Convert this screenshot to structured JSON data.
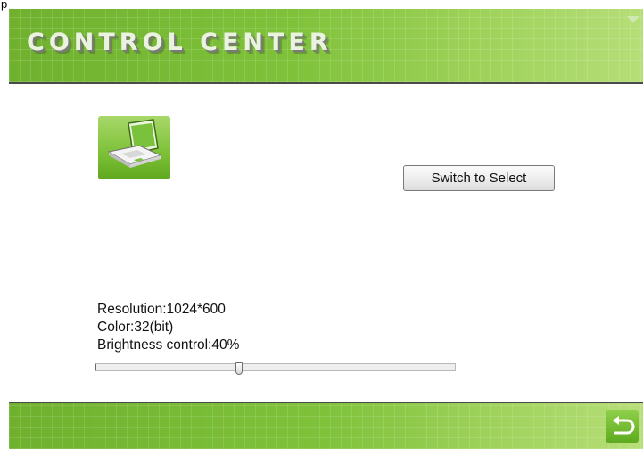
{
  "window": {
    "title": "p"
  },
  "header": {
    "title": "CONTROL CENTER"
  },
  "buttons": {
    "switch_label": "Switch to Select"
  },
  "display": {
    "resolution": "Resolution:1024*600",
    "color": "Color:32(bit)",
    "brightness": "Brightness control:40%"
  },
  "brightness_slider": {
    "value_percent": 40
  },
  "icons": {
    "device": "laptop-icon",
    "back": "return-arrow-icon",
    "collapse": "triangle-down-icon"
  },
  "colors": {
    "accent_green": "#7fc23a",
    "border_dark": "#4a4a4a"
  }
}
